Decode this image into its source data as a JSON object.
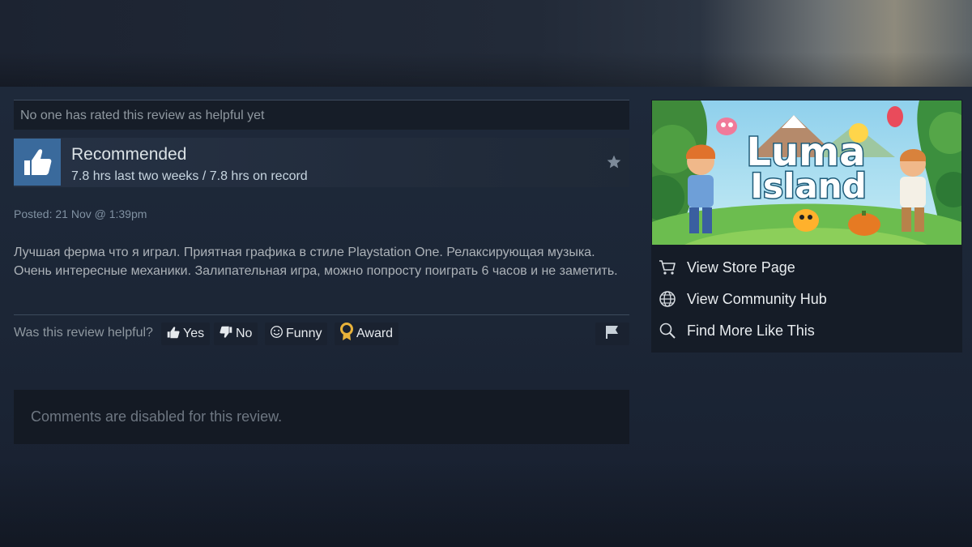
{
  "helpful_status": "No one has rated this review as helpful yet",
  "review": {
    "recommendation": "Recommended",
    "hours": "7.8 hrs last two weeks / 7.8 hrs on record",
    "posted": "Posted: 21 Nov @ 1:39pm",
    "body": "Лучшая ферма что я играл. Приятная графика в стиле Playstation One. Релаксирующая музыка. Очень интересные механики. Залипательная игра, можно попросту поиграть 6 часов и не заметить."
  },
  "feedback": {
    "question": "Was this review helpful?",
    "yes_label": "Yes",
    "no_label": "No",
    "funny_label": "Funny",
    "award_label": "Award"
  },
  "comments_disabled": "Comments are disabled for this review.",
  "game": {
    "logo_line1": "Luma",
    "logo_line2": "Island",
    "links": {
      "store": "View Store Page",
      "hub": "View Community Hub",
      "more": "Find More Like This"
    }
  },
  "colors": {
    "thumb_bg": "#3a6a9c",
    "award_gold": "#e8b23a"
  },
  "icons": [
    "thumbs-up-icon",
    "star-icon",
    "thumbs-down-icon",
    "smiley-icon",
    "award-icon",
    "flag-icon",
    "cart-icon",
    "globe-icon",
    "search-icon"
  ]
}
